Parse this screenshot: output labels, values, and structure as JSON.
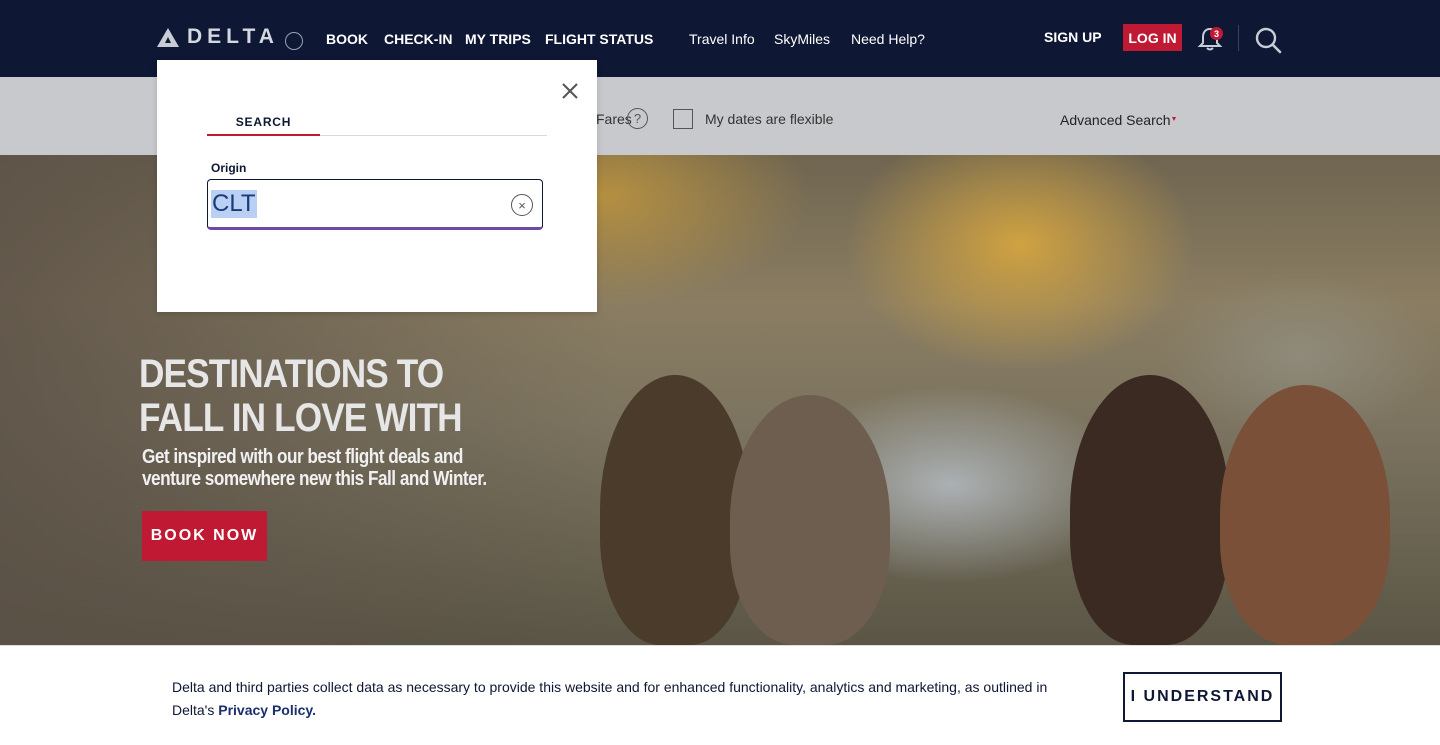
{
  "brand": {
    "name": "DELTA",
    "icons": [
      "delta-triangle-icon",
      "globe-icon"
    ]
  },
  "nav": {
    "primary": [
      {
        "label": "BOOK"
      },
      {
        "label": "CHECK-IN"
      },
      {
        "label": "MY TRIPS"
      },
      {
        "label": "FLIGHT STATUS"
      }
    ],
    "secondary": [
      {
        "label": "Travel Info"
      },
      {
        "label": "SkyMiles"
      },
      {
        "label": "Need Help?"
      }
    ],
    "sign_up": "SIGN UP",
    "log_in": "LOG IN",
    "notifications_count": "3",
    "colors": {
      "background": "#0e1733",
      "accent": "#c01933"
    }
  },
  "search_strip": {
    "fares_label": "Fares",
    "help_glyph": "?",
    "flexible_label": "My dates are flexible",
    "flexible_checked": false,
    "advanced_search": "Advanced Search"
  },
  "popup": {
    "tab_label": "SEARCH",
    "origin_label": "Origin",
    "origin_value": "CLT",
    "clear_glyph": "×"
  },
  "hero": {
    "title_line1": "DESTINATIONS TO",
    "title_line2": "FALL IN LOVE WITH",
    "subtitle_line1": "Get inspired with our best flight deals and",
    "subtitle_line2": "venture somewhere new this Fall and Winter.",
    "cta": "BOOK NOW"
  },
  "cookie": {
    "text": "Delta and third parties collect data as necessary to provide this website and for enhanced functionality, analytics and marketing, as outlined in Delta's ",
    "link": "Privacy Policy.",
    "button": "I UNDERSTAND"
  }
}
